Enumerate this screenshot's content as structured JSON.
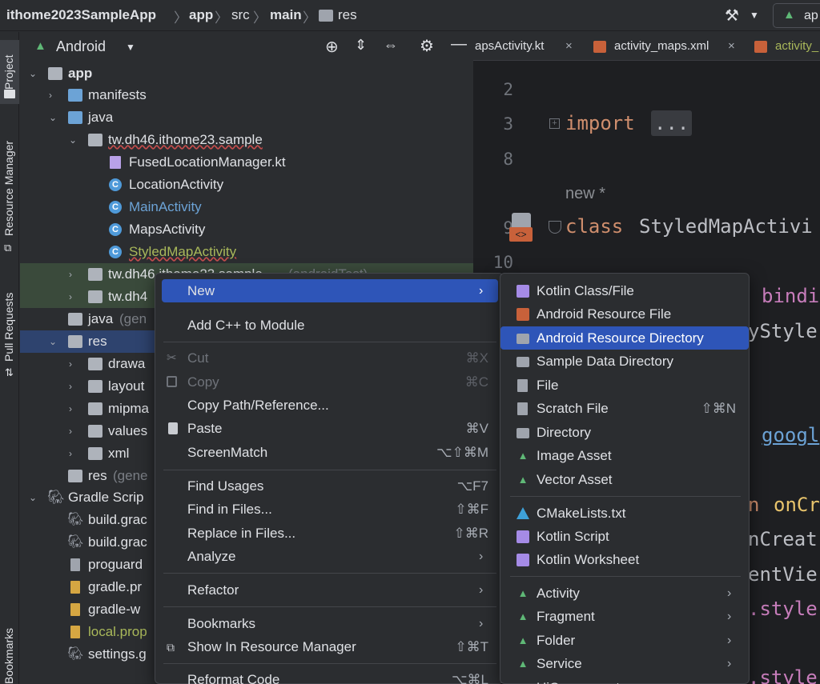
{
  "navbar": {
    "project": "ithome2023SampleApp",
    "module": "app",
    "src": "src",
    "main": "main",
    "res": "res",
    "run_config": "ap"
  },
  "tool_windows": {
    "project": "Project",
    "resource_manager": "Resource Manager",
    "pull_requests": "Pull Requests",
    "bookmarks": "Bookmarks"
  },
  "project_panel": {
    "view_selector": "Android",
    "tree": {
      "app": "app",
      "manifests": "manifests",
      "java": "java",
      "pkg_main": "tw.dh46.ithome23.sample",
      "fused": "FusedLocationManager.kt",
      "location": "LocationActivity",
      "main_activity": "MainActivity",
      "maps": "MapsActivity",
      "styled": "StyledMapActivity",
      "pkg_android_test": "tw.dh46.ithome23.sample",
      "pkg_android_test_suffix": "(androidTest)",
      "pkg_test": "tw.dh4",
      "java_generated": "java",
      "java_generated_suffix": "(gen",
      "res": "res",
      "drawable": "drawa",
      "layout": "layout",
      "mipmap": "mipma",
      "values": "values",
      "xml": "xml",
      "res_generated": "res",
      "res_generated_suffix": "(gene",
      "gradle_scripts": "Gradle Scrip",
      "build1": "build.grac",
      "build2": "build.grac",
      "proguard": "proguard",
      "gradle_props": "gradle.pr",
      "gradle_wrapper": "gradle-w",
      "local_props": "local.prop",
      "settings": "settings.g"
    }
  },
  "editor": {
    "tabs": [
      "MapsActivity.kt",
      "activity_maps.xml",
      "activity_"
    ],
    "tab_first_visible": "apsActivity.kt",
    "lines": {
      "n2": "2",
      "n3": "3",
      "n8": "8",
      "n9": "9",
      "n10": "10",
      "import_kw": "import",
      "import_fold": "...",
      "new_hint": "new *",
      "class_kw": "class",
      "class_name": "StyledMapActivi",
      "frag_bindi": "bindi",
      "frag_ystyle": "yStyle",
      "frag_googl": "googl",
      "frag_n": "n",
      "frag_oncr": "onCr",
      "frag_ncreat": "nCreat",
      "frag_entvie": "entVie",
      "frag_style1": ".style",
      "frag_style2": ".style"
    }
  },
  "context_menu": {
    "items": [
      {
        "label": "New",
        "shortcut": ""
      },
      {
        "label": "Add C++ to Module",
        "shortcut": ""
      },
      {
        "label": "Cut",
        "shortcut": "⌘X"
      },
      {
        "label": "Copy",
        "shortcut": "⌘C"
      },
      {
        "label": "Copy Path/Reference...",
        "shortcut": ""
      },
      {
        "label": "Paste",
        "shortcut": "⌘V"
      },
      {
        "label": "ScreenMatch",
        "shortcut": "⌥⇧⌘M"
      },
      {
        "label": "Find Usages",
        "shortcut": "⌥F7"
      },
      {
        "label": "Find in Files...",
        "shortcut": "⇧⌘F"
      },
      {
        "label": "Replace in Files...",
        "shortcut": "⇧⌘R"
      },
      {
        "label": "Analyze",
        "shortcut": ""
      },
      {
        "label": "Refactor",
        "shortcut": ""
      },
      {
        "label": "Bookmarks",
        "shortcut": ""
      },
      {
        "label": "Show In Resource Manager",
        "shortcut": "⇧⌘T"
      },
      {
        "label": "Reformat Code",
        "shortcut": "⌥⌘L"
      }
    ]
  },
  "new_submenu": {
    "items": [
      {
        "label": "Kotlin Class/File",
        "shortcut": ""
      },
      {
        "label": "Android Resource File",
        "shortcut": ""
      },
      {
        "label": "Android Resource Directory",
        "shortcut": ""
      },
      {
        "label": "Sample Data Directory",
        "shortcut": ""
      },
      {
        "label": "File",
        "shortcut": ""
      },
      {
        "label": "Scratch File",
        "shortcut": "⇧⌘N"
      },
      {
        "label": "Directory",
        "shortcut": ""
      },
      {
        "label": "Image Asset",
        "shortcut": ""
      },
      {
        "label": "Vector Asset",
        "shortcut": ""
      },
      {
        "label": "CMakeLists.txt",
        "shortcut": ""
      },
      {
        "label": "Kotlin Script",
        "shortcut": ""
      },
      {
        "label": "Kotlin Worksheet",
        "shortcut": ""
      },
      {
        "label": "Activity",
        "shortcut": ""
      },
      {
        "label": "Fragment",
        "shortcut": ""
      },
      {
        "label": "Folder",
        "shortcut": ""
      },
      {
        "label": "Service",
        "shortcut": ""
      },
      {
        "label": "UiComponent",
        "shortcut": ""
      }
    ],
    "selected": "Android Resource Directory"
  },
  "colors": {
    "menu_selection": "#2e55b8",
    "tree_selection": "#2e436e",
    "android_green": "#5fb876",
    "link_blue": "#6ca3d6",
    "warn_yellow": "#a9b85a"
  }
}
